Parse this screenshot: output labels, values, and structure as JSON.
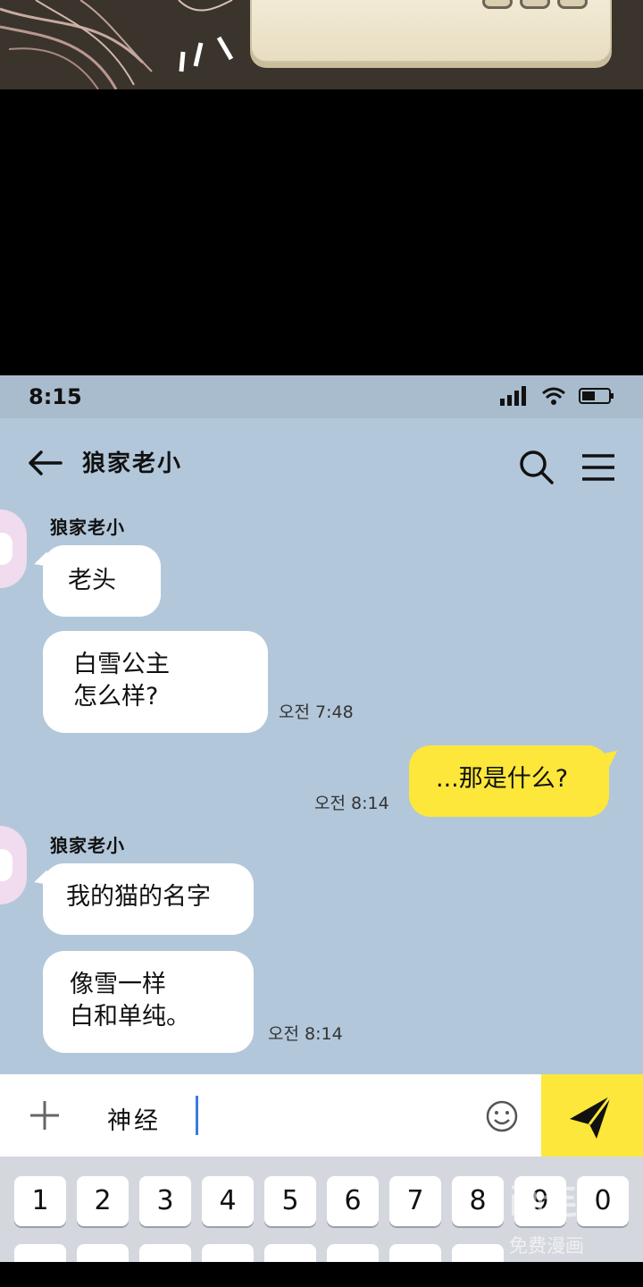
{
  "status": {
    "time": "8:15"
  },
  "chat": {
    "title": "狼家老小"
  },
  "messages": [
    {
      "sender": "狼家老小",
      "text": "老头"
    },
    {
      "line1": "白雪公主",
      "line2": "怎么样?",
      "time": "오전 7:48"
    },
    {
      "text": "...那是什么?",
      "time": "오전 8:14"
    },
    {
      "sender": "狼家老小",
      "text": "我的猫的名字"
    },
    {
      "line1": "像雪一样",
      "line2": "白和单纯。",
      "time": "오전 8:14"
    }
  ],
  "input": {
    "value": "神经"
  },
  "keyboard": {
    "keys": [
      "1",
      "2",
      "3",
      "4",
      "5",
      "6",
      "7",
      "8",
      "9",
      "0"
    ]
  },
  "watermark": {
    "title": "画连",
    "subtitle": "免费漫画"
  },
  "colors": {
    "chat_background": "#b2c7da",
    "my_bubble": "#fce73a",
    "send_button": "#fce73a",
    "caret": "#3b7be0"
  }
}
